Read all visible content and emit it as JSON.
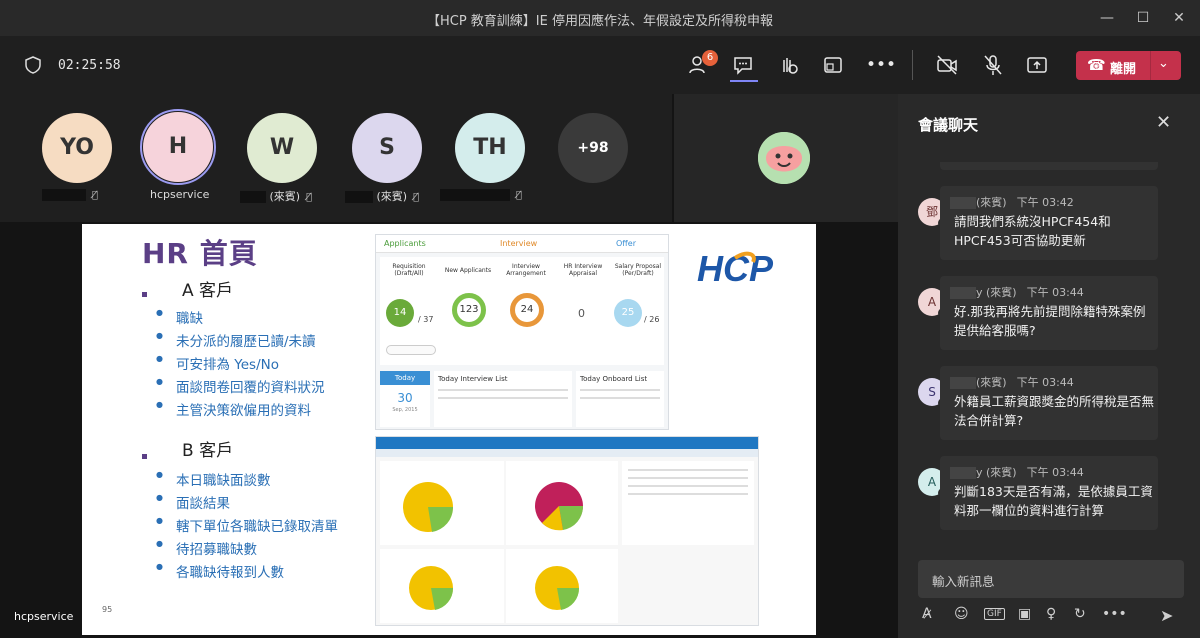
{
  "window": {
    "title": "【HCP 教育訓練】IE 停用因應作法、年假設定及所得稅申報",
    "controls": [
      "—",
      "☐",
      "✕"
    ]
  },
  "toolbar": {
    "timer": "02:25:58",
    "participants_count": "6",
    "leave_label": "離開",
    "icons": [
      "people-icon",
      "chat-icon",
      "reactions-icon",
      "share-tray-icon",
      "more-icon",
      "camera-off-icon",
      "mic-off-icon",
      "share-screen-icon"
    ]
  },
  "participants": [
    {
      "initials": "YO",
      "name": "",
      "color": "#f6dcc2"
    },
    {
      "initials": "H",
      "name": "hcpservice",
      "color": "#f6d3db"
    },
    {
      "initials": "W",
      "name": "(來賓)",
      "color": "#e0ebd2"
    },
    {
      "initials": "S",
      "name": "(來賓)",
      "color": "#dcd7ee"
    },
    {
      "initials": "TH",
      "name": "",
      "color": "#d4edec"
    },
    {
      "initials": "+98",
      "name": "",
      "color": "#3a3a3a"
    }
  ],
  "slide": {
    "title": "HR 首頁",
    "section_a": "A 客戶",
    "items_a": [
      "職缺",
      "未分派的履歷已讀/未讀",
      "可安排為 Yes/No",
      "面談問卷回覆的資料狀況",
      "主管決策欲僱用的資料"
    ],
    "section_b": "B 客戶",
    "items_b": [
      "本日職缺面談數",
      "面談結果",
      "轄下單位各職缺已錄取清單",
      "待招募職缺數",
      "各職缺待報到人數"
    ],
    "page_number": "95",
    "logo_text": "HCP",
    "dashboard": {
      "tabs": [
        "Applicants",
        "Interview",
        "Offer"
      ],
      "columns": [
        "Requisition (Draft/All)",
        "New Applicants",
        "Interview Arrangement",
        "HR Interview Appraisal",
        "Salary Proposal (Per/Draft)"
      ],
      "values": [
        "14",
        "/ 37",
        "123",
        "24",
        "0",
        "25",
        "/ 26"
      ],
      "today_label": "Today",
      "today_day": "30",
      "today_month": "Sep, 2015",
      "interview_list_title": "Today Interview List",
      "onboard_list_title": "Today Onboard List"
    }
  },
  "presenter": "hcpservice",
  "chat": {
    "title": "會議聊天",
    "messages": [
      {
        "avatar": "鄧",
        "sender": "(來賓)",
        "time": "下午 03:42",
        "text": "請問我們系統沒HPCF454和HPCF453可否協助更新"
      },
      {
        "avatar": "A",
        "sender": "y (來賓)",
        "time": "下午 03:44",
        "text": "好.那我再將先前提問除籍特殊案例提供給客服嗎?"
      },
      {
        "avatar": "S",
        "sender": "(來賓)",
        "time": "下午 03:44",
        "text": "外籍員工薪資跟獎金的所得稅是否無法合併計算?"
      },
      {
        "avatar": "A",
        "sender": "y (來賓)",
        "time": "下午 03:44",
        "text": "判斷183天是否有滿，是依據員工資料那一欄位的資料進行計算"
      }
    ],
    "compose_placeholder": "輸入新訊息",
    "compose_tools": [
      "format-icon",
      "emoji-icon",
      "gif-icon",
      "sticker-icon",
      "praise-icon",
      "loop-icon",
      "more-icon",
      "send-icon"
    ]
  }
}
